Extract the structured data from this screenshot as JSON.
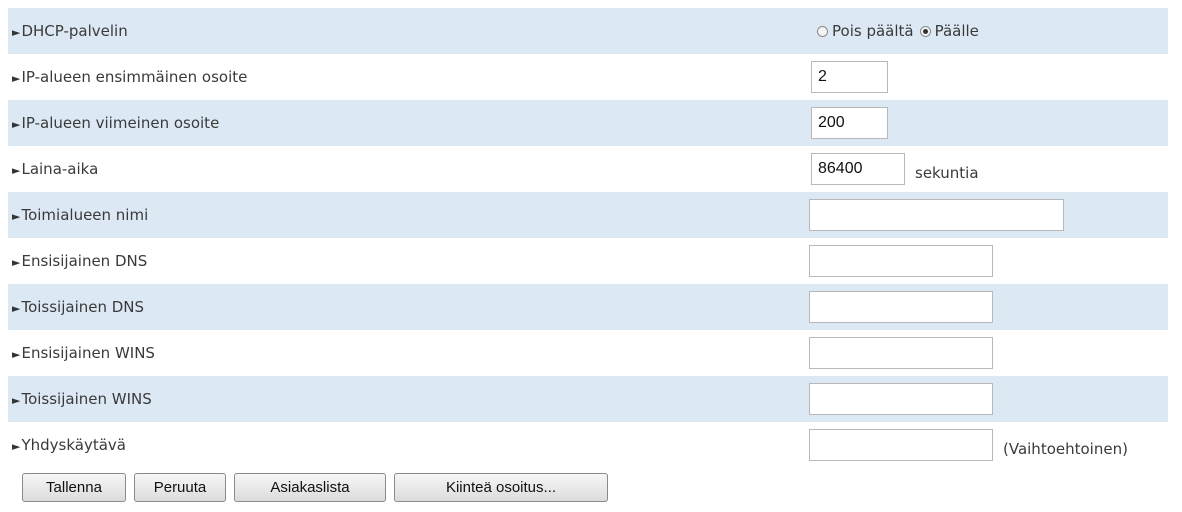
{
  "form": {
    "rows": [
      {
        "label": "DHCP-palvelin"
      },
      {
        "label": "IP-alueen ensimmäinen osoite",
        "value": "2"
      },
      {
        "label": "IP-alueen viimeinen osoite",
        "value": "200"
      },
      {
        "label": "Laina-aika",
        "value": "86400",
        "suffix": "sekuntia"
      },
      {
        "label": "Toimialueen nimi",
        "value": ""
      },
      {
        "label": "Ensisijainen DNS",
        "value": ""
      },
      {
        "label": "Toissijainen DNS",
        "value": ""
      },
      {
        "label": "Ensisijainen WINS",
        "value": ""
      },
      {
        "label": "Toissijainen WINS",
        "value": ""
      },
      {
        "label": "Yhdyskäytävä",
        "value": "",
        "suffix": "(Vaihtoehtoinen)"
      }
    ],
    "dhcp_radio": {
      "off_label": "Pois päältä",
      "on_label": "Päälle",
      "selected": "on"
    }
  },
  "buttons": {
    "save": "Tallenna",
    "cancel": "Peruuta",
    "client_list": "Asiakaslista",
    "static_address": "Kiinteä osoitus..."
  },
  "colors": {
    "row_shade": "#dce9f5"
  }
}
